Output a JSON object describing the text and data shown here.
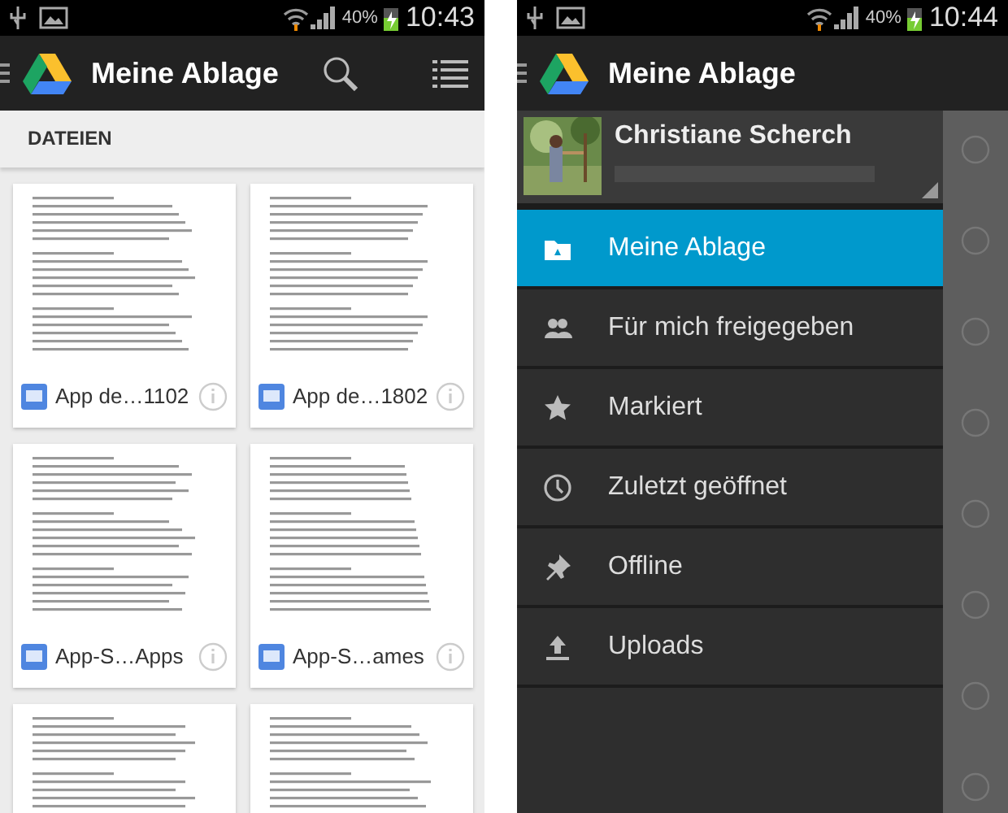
{
  "screens": [
    {
      "status_bar": {
        "battery": "40%",
        "time": "10:43"
      },
      "app_bar": {
        "title": "Meine Ablage"
      },
      "section_header": "DATEIEN",
      "files": [
        {
          "kind": "document",
          "name": "App de…1102"
        },
        {
          "kind": "document",
          "name": "App de…1802"
        },
        {
          "kind": "document",
          "name": "App-S…Apps"
        },
        {
          "kind": "document",
          "name": "App-S…ames"
        },
        {
          "kind": "preview"
        },
        {
          "kind": "preview"
        }
      ]
    },
    {
      "status_bar": {
        "battery": "40%",
        "time": "10:44"
      },
      "app_bar": {
        "title": "Meine Ablage"
      },
      "drawer": {
        "account": {
          "name": "Christiane Scherch"
        },
        "items": [
          {
            "label": "Meine Ablage",
            "kind": "drive",
            "selected": true
          },
          {
            "label": "Für mich freigegeben",
            "kind": "people",
            "selected": false
          },
          {
            "label": "Markiert",
            "kind": "star",
            "selected": false
          },
          {
            "label": "Zuletzt geöffnet",
            "kind": "clock",
            "selected": false
          },
          {
            "label": "Offline",
            "kind": "pin",
            "selected": false
          },
          {
            "label": "Uploads",
            "kind": "upload",
            "selected": false
          }
        ]
      }
    }
  ]
}
